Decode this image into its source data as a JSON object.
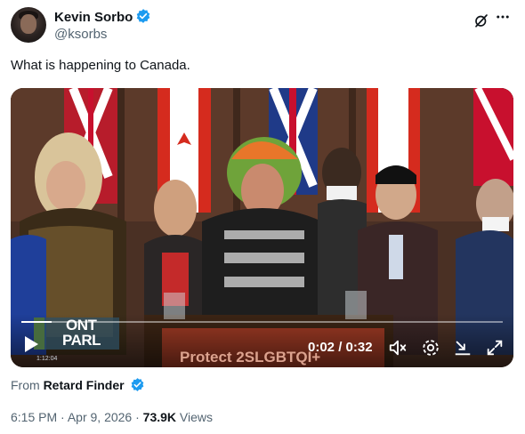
{
  "author": {
    "name": "Kevin Sorbo",
    "handle": "@ksorbs",
    "verified": true
  },
  "actions": {
    "more_icon": "more-horizontal-icon",
    "grok_icon": "grok-icon"
  },
  "tweet": {
    "text": "What is happening to Canada."
  },
  "video": {
    "overlay_channel": [
      "ONT",
      "PARL"
    ],
    "podium_sign": "Protect 2SLGBTQI+",
    "timecode": "0:02 / 0:32",
    "progress": 0.0625,
    "stamp": "1:12:04",
    "controls": [
      "play-icon",
      "mute-icon",
      "settings-icon",
      "minimize-icon",
      "fullscreen-icon"
    ]
  },
  "source": {
    "from_label": "From",
    "account": "Retard Finder",
    "verified": true
  },
  "meta": {
    "time": "6:15 PM",
    "separator": "·",
    "date": "Apr 9, 2026",
    "views_count": "73.9K",
    "views_label": "Views"
  },
  "colors": {
    "verified": "#1d9bf0",
    "muted_text": "#536471",
    "primary_text": "#0f1419"
  }
}
